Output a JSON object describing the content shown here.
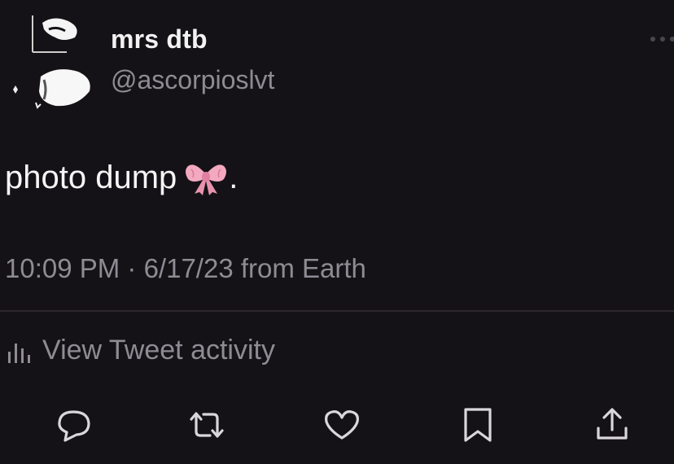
{
  "tweet": {
    "display_name": "mrs dtb",
    "handle": "@ascorpioslvt",
    "text": "photo dump",
    "text_suffix": ".",
    "emoji": "bow-emoji",
    "timestamp": "10:09 PM · 6/17/23 from Earth"
  },
  "activity": {
    "label": "View Tweet activity",
    "icon": "bar-chart-icon"
  },
  "actions": [
    {
      "name": "reply",
      "icon": "reply-icon"
    },
    {
      "name": "retweet",
      "icon": "retweet-icon"
    },
    {
      "name": "like",
      "icon": "heart-icon"
    },
    {
      "name": "bookmark",
      "icon": "bookmark-icon"
    },
    {
      "name": "share",
      "icon": "share-icon"
    }
  ],
  "colors": {
    "background": "#141216",
    "text_primary": "#f5f5f5",
    "text_secondary": "#8f8b94",
    "divider": "#2c272d",
    "bow": "#f3a9c0"
  }
}
